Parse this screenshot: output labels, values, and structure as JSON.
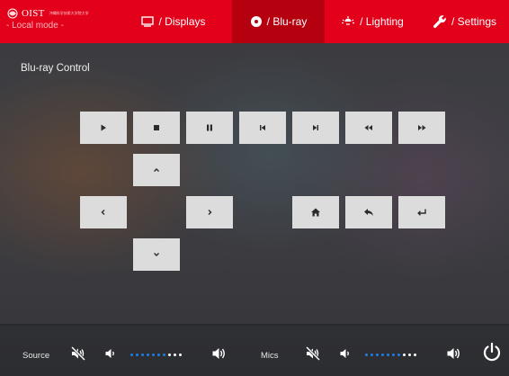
{
  "header": {
    "brand_name": "OIST",
    "brand_tag": "沖縄科学技術大学院大学",
    "mode": "- Local mode -",
    "tabs": [
      {
        "id": "displays",
        "label": "/ Displays",
        "icon": "display-icon",
        "active": false
      },
      {
        "id": "bluray",
        "label": "/ Blu-ray",
        "icon": "disc-icon",
        "active": true
      },
      {
        "id": "lighting",
        "label": "/ Lighting",
        "icon": "lightbulb-icon",
        "active": false
      },
      {
        "id": "settings",
        "label": "/ Settings",
        "icon": "wrench-icon",
        "active": false
      }
    ]
  },
  "main": {
    "title": "Blu-ray Control",
    "transport_buttons": [
      "play-icon",
      "stop-icon",
      "pause-icon",
      "previous-track-icon",
      "next-track-icon",
      "rewind-icon",
      "fast-forward-icon"
    ],
    "navigation_buttons": [
      "chevron-up-icon",
      "chevron-left-icon",
      "chevron-right-icon",
      "chevron-down-icon"
    ],
    "function_buttons": [
      "home-icon",
      "back-icon",
      "enter-icon"
    ]
  },
  "footer": {
    "source": {
      "label": "Source",
      "level_dots_filled": 7,
      "level_dots_total": 10
    },
    "mics": {
      "label": "Mics",
      "level_dots_filled": 7,
      "level_dots_total": 10
    },
    "power_icon": "power-icon"
  },
  "colors": {
    "header_red": "#e2001a",
    "active_tab": "#b4000f",
    "button_bg": "#dcdcdc",
    "button_icon": "#2b2b2b",
    "level_on": "#1e7fe6",
    "level_off": "#ffffff"
  }
}
